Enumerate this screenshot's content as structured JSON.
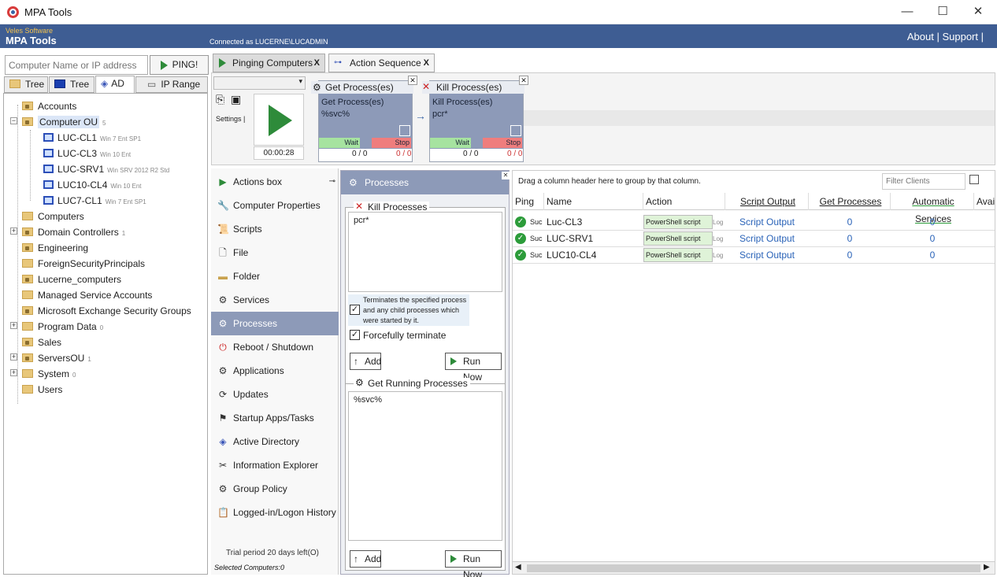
{
  "window": {
    "title": "MPA Tools",
    "minimize": "—",
    "maximize": "☐",
    "close": "✕"
  },
  "banner": {
    "vendor": "Veles Software",
    "product": "MPA Tools",
    "connection": "Connected as LUCERNE\\LUCADMIN",
    "about": "About |",
    "support": "Support |"
  },
  "search": {
    "placeholder": "Computer Name or IP address",
    "ping_label": "PING!"
  },
  "left_tabs": [
    "Tree 1",
    "Tree 2",
    "AD",
    "IP Range"
  ],
  "tree": [
    {
      "label": "Accounts",
      "note": ""
    },
    {
      "label": "Computer OU",
      "note": "5"
    },
    {
      "label": "LUC-CL1",
      "note": "Win 7 Ent SP1"
    },
    {
      "label": "LUC-CL3",
      "note": "Win 10 Ent"
    },
    {
      "label": "LUC-SRV1",
      "note": "Win SRV 2012 R2 Std"
    },
    {
      "label": "LUC10-CL4",
      "note": "Win 10 Ent"
    },
    {
      "label": "LUC7-CL1",
      "note": "Win 7 Ent SP1"
    },
    {
      "label": "Computers",
      "note": ""
    },
    {
      "label": "Domain Controllers",
      "note": "1"
    },
    {
      "label": "Engineering",
      "note": ""
    },
    {
      "label": "ForeignSecurityPrincipals",
      "note": ""
    },
    {
      "label": "Lucerne_computers",
      "note": ""
    },
    {
      "label": "Managed Service Accounts",
      "note": ""
    },
    {
      "label": "Microsoft Exchange Security Groups",
      "note": ""
    },
    {
      "label": "Program Data",
      "note": "0"
    },
    {
      "label": "Sales",
      "note": ""
    },
    {
      "label": "ServersOU",
      "note": "1"
    },
    {
      "label": "System",
      "note": "0"
    },
    {
      "label": "Users",
      "note": ""
    }
  ],
  "top_tabs": [
    {
      "label": "Pinging Computers",
      "close": "X"
    },
    {
      "label": "Action Sequence",
      "close": "X"
    }
  ],
  "sequence": {
    "settings_label": "Settings |",
    "timer": "00:00:28",
    "cards": [
      {
        "header": "Get Process(es)",
        "title": "Get Process(es)",
        "value": "%svc%",
        "wait": "Wait",
        "stop": "Stop",
        "count_a": "0 / 0",
        "count_b": "0 / 0"
      },
      {
        "header": "Kill Process(es)",
        "title": "Kill Process(es)",
        "value": "pcr*",
        "wait": "Wait",
        "stop": "Stop",
        "count_a": "0 / 0",
        "count_b": "0 / 0"
      }
    ]
  },
  "actions": [
    {
      "label": "Actions box",
      "icon": "play-icon"
    },
    {
      "label": "Computer Properties",
      "icon": "wrench-icon"
    },
    {
      "label": "Scripts",
      "icon": "script-icon"
    },
    {
      "label": "File",
      "icon": "file-icon"
    },
    {
      "label": "Folder",
      "icon": "folder-icon"
    },
    {
      "label": "Services",
      "icon": "gear-icon"
    },
    {
      "label": "Processes",
      "icon": "processes-icon"
    },
    {
      "label": "Reboot / Shutdown",
      "icon": "power-icon"
    },
    {
      "label": "Applications",
      "icon": "applications-icon"
    },
    {
      "label": "Updates",
      "icon": "updates-icon"
    },
    {
      "label": "Startup Apps/Tasks",
      "icon": "flag-icon"
    },
    {
      "label": "Active Directory",
      "icon": "active-directory-icon"
    },
    {
      "label": "Information Explorer",
      "icon": "tools-icon"
    },
    {
      "label": "Group Policy",
      "icon": "group-policy-icon"
    },
    {
      "label": "Logged-in/Logon History",
      "icon": "history-icon"
    }
  ],
  "trial": "Trial period 20 days left(O)",
  "selected": "Selected Computers:0",
  "processes_panel": {
    "title": "Processes",
    "kill_title": "Kill Processes",
    "kill_value": "pcr*",
    "terminate_children": "Terminates the specified process and any child processes which were started by it.",
    "force_label": "Forcefully terminate",
    "add_label": "Add",
    "run_label": "Run Now",
    "get_title": "Get Running Processes",
    "get_value": "%svc%"
  },
  "grid": {
    "group_hint": "Drag a column header here to group by that column.",
    "filter_placeholder": "Filter Clients",
    "columns": [
      "Ping",
      "Name",
      "Action",
      "Script Output",
      "Get Processes",
      "Automatic Services",
      "Avail"
    ],
    "rows": [
      {
        "ping": "Suc",
        "name": "Luc-CL3",
        "action": "PowerShell script",
        "log": "Log",
        "output": "Script Output",
        "get_processes": "0",
        "auto_services": "0"
      },
      {
        "ping": "Suc",
        "name": "LUC-SRV1",
        "action": "PowerShell script",
        "log": "Log",
        "output": "Script Output",
        "get_processes": "0",
        "auto_services": "0"
      },
      {
        "ping": "Suc",
        "name": "LUC10-CL4",
        "action": "PowerShell script",
        "log": "Log",
        "output": "Script Output",
        "get_processes": "0",
        "auto_services": "0"
      }
    ]
  }
}
